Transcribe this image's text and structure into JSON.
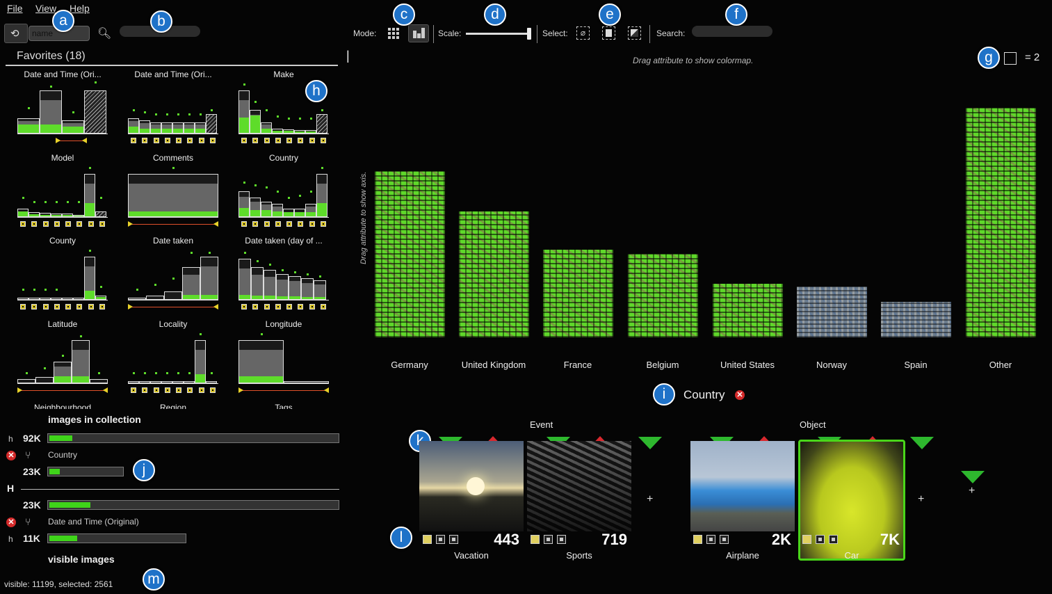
{
  "menubar": {
    "file": "File",
    "view": "View",
    "help": "Help"
  },
  "toolbar": {
    "sort_field": "name",
    "mode_label": "Mode:",
    "scale_label": "Scale:",
    "scale_value": 1.0,
    "select_label": "Select:",
    "search_label": "Search:"
  },
  "callouts": [
    "a",
    "b",
    "c",
    "d",
    "e",
    "f",
    "g",
    "h",
    "i",
    "j",
    "k",
    "l",
    "m"
  ],
  "favorites": {
    "title": "Favorites (18)",
    "items": [
      {
        "label": "Date and Time (Ori..."
      },
      {
        "label": "Date and Time (Ori..."
      },
      {
        "label": "Make"
      },
      {
        "label": "Model"
      },
      {
        "label": "Comments"
      },
      {
        "label": "Country"
      },
      {
        "label": "County"
      },
      {
        "label": "Date taken"
      },
      {
        "label": "Date taken (day of ..."
      },
      {
        "label": "Latitude"
      },
      {
        "label": "Locality"
      },
      {
        "label": "Longitude"
      },
      {
        "label": "Neighbourhood"
      },
      {
        "label": "Region"
      },
      {
        "label": "Tags"
      }
    ]
  },
  "stats": {
    "collection_label": "images in collection",
    "rows": [
      {
        "prefix": "h",
        "value": "92K",
        "fill": 0.08
      },
      {
        "prefix": "",
        "value": "Country",
        "type": "filter"
      },
      {
        "prefix": "",
        "value": "23K",
        "fill": 0.08
      },
      {
        "prefix": "H",
        "value": "",
        "type": "divider"
      },
      {
        "prefix": "",
        "value": "23K",
        "fill": 0.14
      },
      {
        "prefix": "",
        "value": "Date and Time (Original)",
        "type": "filter"
      },
      {
        "prefix": "h",
        "value": "11K",
        "fill": 0.2
      }
    ],
    "visible_label": "visible images",
    "status": "visible: 11199, selected: 2561"
  },
  "chart": {
    "colormap_hint": "Drag attribute to show colormap.",
    "axis_hint": "Drag attribute to show axis.",
    "scale_box_value": "= 2",
    "axis_attribute": "Country",
    "tick_marker": "|"
  },
  "chart_data": {
    "type": "bar",
    "title": "",
    "xlabel": "Country",
    "ylabel": "",
    "categories": [
      "Germany",
      "United Kingdom",
      "France",
      "Belgium",
      "United States",
      "Norway",
      "Spain",
      "Other"
    ],
    "values": [
      235,
      178,
      124,
      118,
      76,
      72,
      50,
      325
    ],
    "highlighted": [
      true,
      true,
      true,
      true,
      true,
      false,
      false,
      true
    ]
  },
  "concepts": {
    "event_label": "Event",
    "object_label": "Object",
    "items": [
      {
        "label": "Vacation",
        "count": "443"
      },
      {
        "label": "Sports",
        "count": "719"
      },
      {
        "label": "Airplane",
        "count": "2K"
      },
      {
        "label": "Car",
        "count": "7K"
      }
    ],
    "plus": "+"
  },
  "colors": {
    "accent_green": "#5edc2a",
    "callout_blue": "#1f72c8",
    "remove_red": "#d42a2a",
    "background": "#050505"
  },
  "icons": {
    "menu": "refresh-icon",
    "search": "search-icon",
    "remove": "close-icon",
    "merge": "split-icon"
  }
}
